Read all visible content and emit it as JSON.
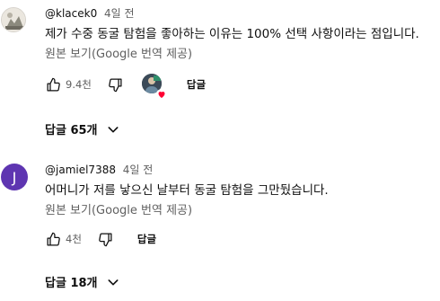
{
  "comments": [
    {
      "author": "@klacek0",
      "time": "4일 전",
      "text": "제가 수중 동굴 탐험을 좋아하는 이유는 100% 선택 사항이라는 점입니다.",
      "translate_label": "원본 보기(Google 번역 제공)",
      "like_count": "9.4천",
      "reply_label": "답글",
      "replies_label": "답글 65개",
      "avatar_type": "image",
      "creator_heart": true
    },
    {
      "author": "@jamiel7388",
      "time": "4일 전",
      "text": "어머니가 저를 낳으신 날부터 동굴 탐험을 그만뒀습니다.",
      "translate_label": "원본 보기(Google 번역 제공)",
      "like_count": "4천",
      "reply_label": "답글",
      "replies_label": "답글 18개",
      "avatar_type": "letter",
      "avatar_letter": "J",
      "avatar_color": "#5e35b1",
      "creator_heart": false
    }
  ],
  "icons": {
    "like": "thumbs-up-icon",
    "dislike": "thumbs-down-icon",
    "expand": "chevron-down-icon",
    "heart": "heart-icon"
  },
  "colors": {
    "text_primary": "#0f0f0f",
    "text_secondary": "#606060",
    "heart": "#ff0033",
    "avatar_j": "#5e35b1"
  }
}
